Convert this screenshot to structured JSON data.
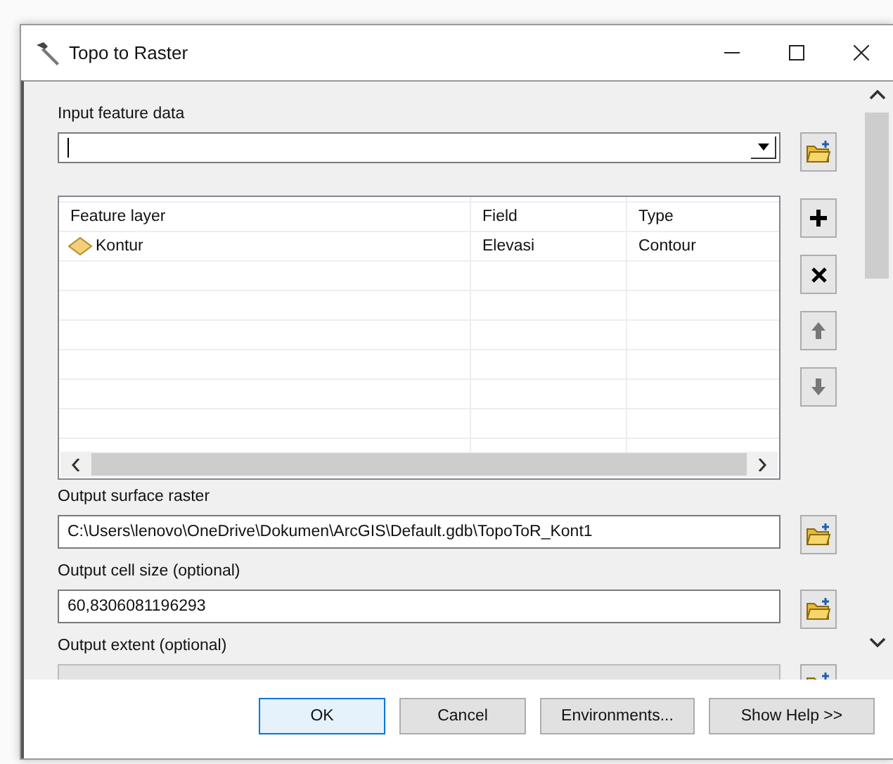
{
  "window": {
    "title": "Topo to Raster"
  },
  "input_feature_data": {
    "label": "Input feature data"
  },
  "feature_table": {
    "columns": [
      "Feature layer",
      "Field",
      "Type"
    ],
    "rows": [
      {
        "feature_layer": "Kontur",
        "field": "Elevasi",
        "type": "Contour"
      }
    ]
  },
  "table_tools": [
    {
      "kind": "add",
      "disabled": false
    },
    {
      "kind": "remove",
      "disabled": false
    },
    {
      "kind": "up",
      "disabled": true
    },
    {
      "kind": "down",
      "disabled": true
    }
  ],
  "output_surface_raster": {
    "label": "Output surface raster",
    "value": "C:\\Users\\lenovo\\OneDrive\\Dokumen\\ArcGIS\\Default.gdb\\TopoToR_Kont1"
  },
  "output_cell_size": {
    "label": "Output cell size (optional)",
    "value": "60,8306081196293"
  },
  "output_extent": {
    "label": "Output extent (optional)",
    "disabled": true
  },
  "footer_buttons": [
    {
      "label": "OK",
      "default": true
    },
    {
      "label": "Cancel",
      "default": false
    },
    {
      "label": "Environments...",
      "default": false
    },
    {
      "label": "Show Help >>",
      "default": false
    }
  ]
}
